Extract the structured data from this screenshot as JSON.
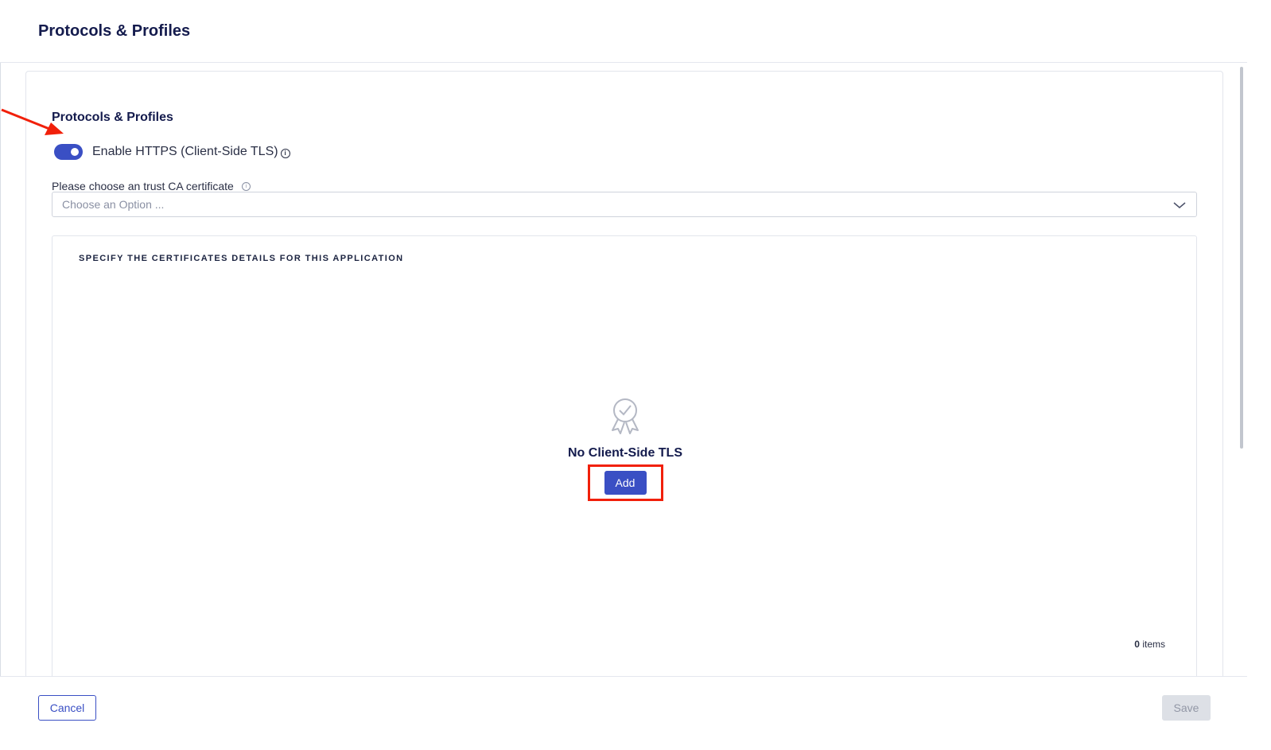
{
  "header": {
    "title": "Protocols & Profiles"
  },
  "section": {
    "title": "Protocols & Profiles",
    "toggle": {
      "label": "Enable HTTPS (Client-Side TLS)",
      "enabled": true,
      "info_icon": "info-icon",
      "info_glyph": "i"
    },
    "ca": {
      "label": "Please choose an trust CA certificate",
      "info_glyph": "i",
      "placeholder": "Choose an Option ..."
    }
  },
  "certificates": {
    "heading": "SPECIFY THE CERTIFICATES DETAILS FOR THIS APPLICATION",
    "empty_icon": "certificate-badge-icon",
    "empty_text": "No Client-Side TLS",
    "add_label": "Add",
    "items_count": "0",
    "items_label": " items"
  },
  "footer": {
    "cancel_label": "Cancel",
    "save_label": "Save",
    "save_disabled": true
  },
  "colors": {
    "accent": "#3a4fc4",
    "annotation_red": "#f1200a",
    "title": "#141b4d"
  }
}
